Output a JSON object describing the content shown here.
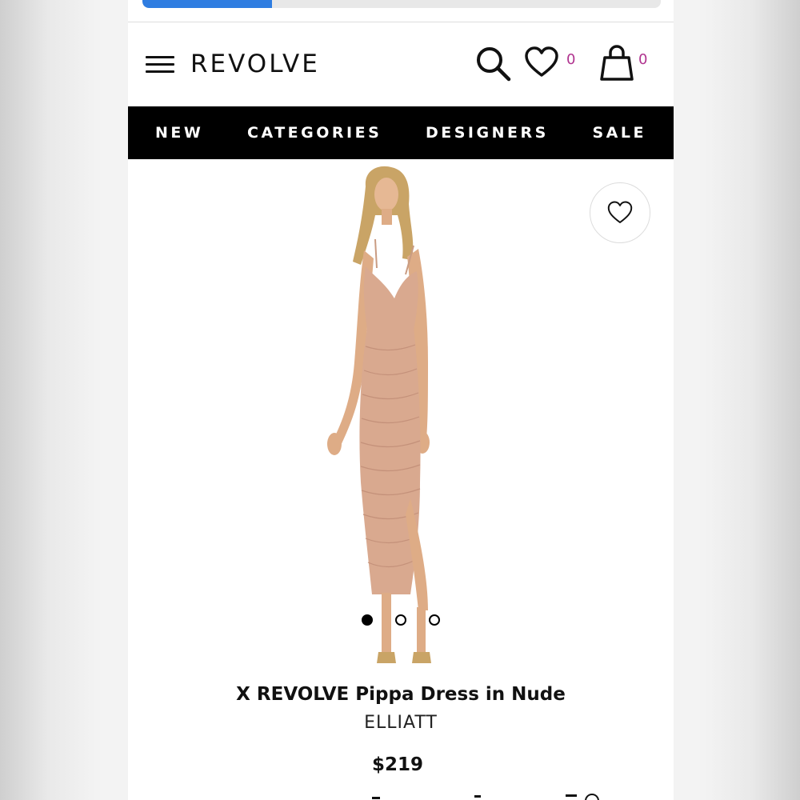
{
  "browser": {
    "load_progress": 0.25
  },
  "header": {
    "logo": "REVOLVE",
    "wishlist_count": "0",
    "bag_count": "0"
  },
  "nav": {
    "items": [
      {
        "label": "NEW"
      },
      {
        "label": "CATEGORIES"
      },
      {
        "label": "DESIGNERS"
      },
      {
        "label": "SALE"
      }
    ]
  },
  "product": {
    "title": "X REVOLVE Pippa Dress in Nude",
    "brand": "ELLIATT",
    "price": "$219",
    "image_count": 3,
    "active_image": 1
  },
  "colors": {
    "accent_count": "#b0338f",
    "progress": "#2f7de1",
    "navbar": "#000000",
    "dress": "#d9a98f"
  },
  "icons": [
    "hamburger-icon",
    "search-icon",
    "heart-icon",
    "shopping-bag-icon",
    "share-icons"
  ]
}
